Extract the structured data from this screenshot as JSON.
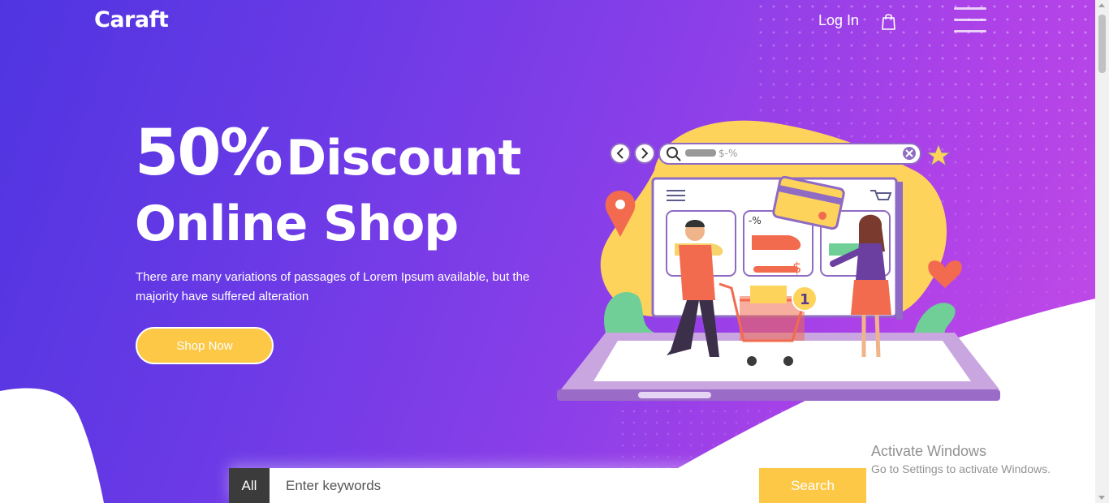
{
  "brand": {
    "name": "Caraft"
  },
  "nav": {
    "login_label": "Log In",
    "cart_icon": "shopping-bag-icon",
    "menu_icon": "hamburger-menu-icon"
  },
  "hero": {
    "headline_pct": "50%",
    "headline_word": "Discount",
    "headline_line2": "Online Shop",
    "description": "There are many variations of passages of Lorem Ipsum available, but the majority have suffered alteration",
    "cta_label": "Shop Now"
  },
  "illustration": {
    "search_text": "$-%",
    "discount_tag": "-%",
    "price_tag": "$",
    "cart_badge": "1"
  },
  "search": {
    "category_label": "All",
    "placeholder": "Enter keywords",
    "button_label": "Search"
  },
  "watermark": {
    "title": "Activate Windows",
    "subtitle": "Go to Settings to activate Windows."
  },
  "colors": {
    "gradient_start": "#4f35e0",
    "gradient_end": "#c24be6",
    "accent_yellow": "#fcc846",
    "dark": "#3b3b3b"
  }
}
